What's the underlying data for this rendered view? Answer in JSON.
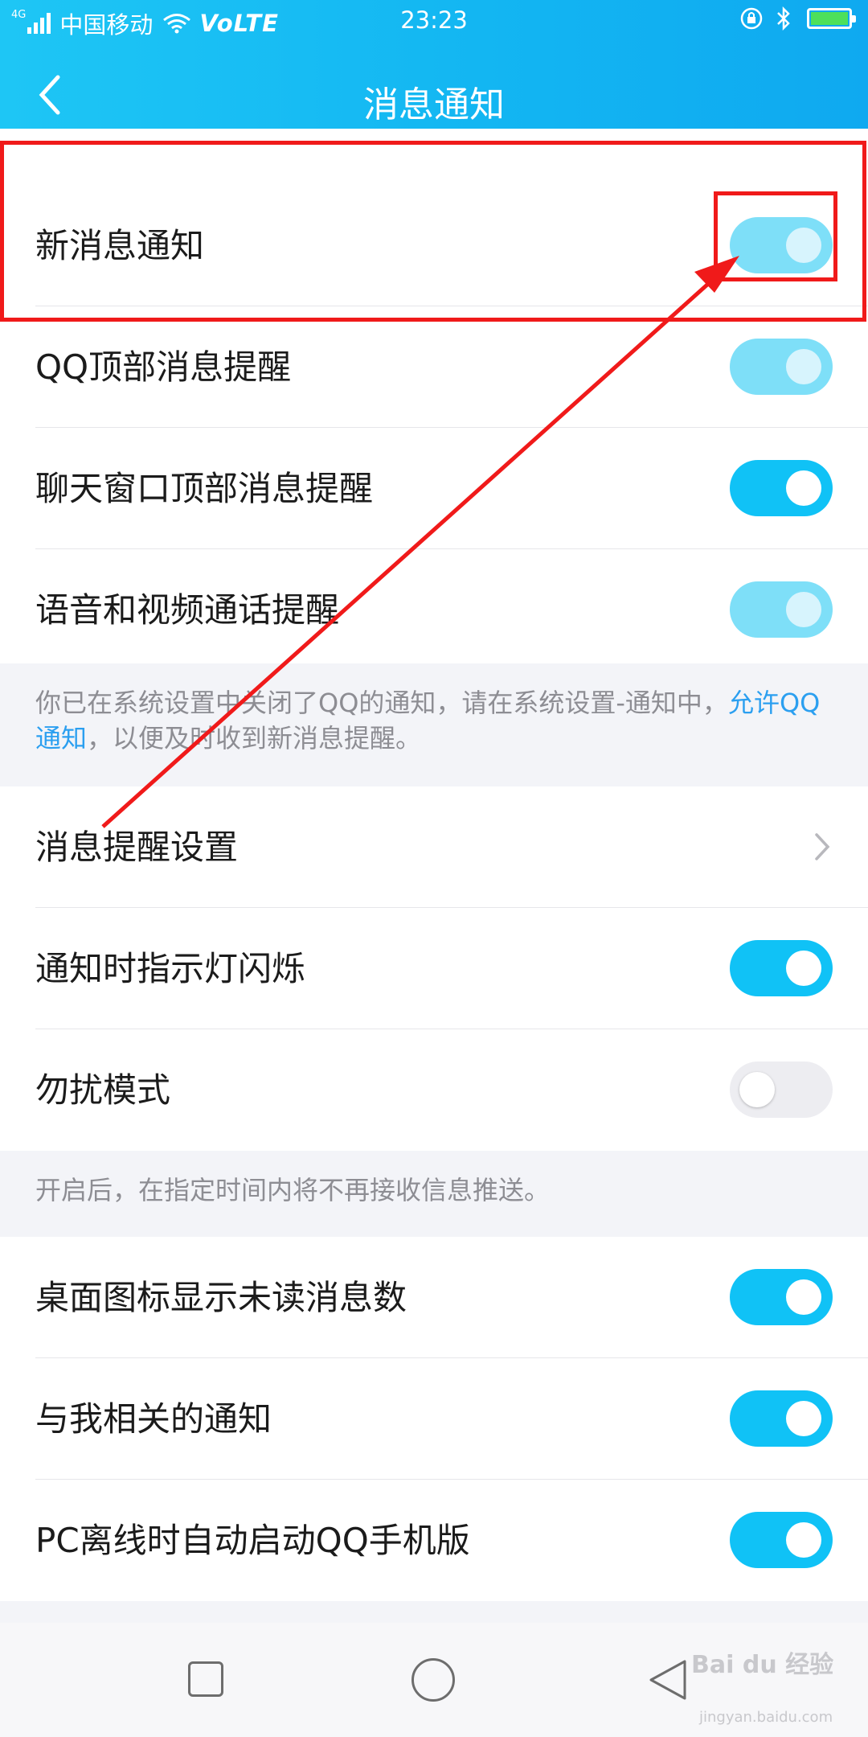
{
  "status_bar": {
    "network_small": "4G",
    "carrier": "中国移动",
    "volte": "VoLTE",
    "time": "23:23",
    "icons": [
      "signal-icon",
      "wifi-icon",
      "orientation-lock-icon",
      "bluetooth-icon",
      "battery-charging-icon"
    ]
  },
  "header": {
    "title": "消息通知",
    "back_icon": "back-chevron-icon"
  },
  "section1": {
    "items": [
      {
        "label": "新消息通知",
        "toggle": "on-disabled"
      },
      {
        "label": "QQ顶部消息提醒",
        "toggle": "on-disabled"
      },
      {
        "label": "聊天窗口顶部消息提醒",
        "toggle": "on"
      },
      {
        "label": "语音和视频通话提醒",
        "toggle": "on-disabled"
      }
    ]
  },
  "note1": {
    "text_before": "你已在系统设置中关闭了QQ的通知，请在系统设置-通知中，",
    "link": "允许QQ通知",
    "text_after": "，以便及时收到新消息提醒。"
  },
  "section2": {
    "items": [
      {
        "label": "消息提醒设置",
        "type": "chevron"
      },
      {
        "label": "通知时指示灯闪烁",
        "toggle": "on"
      },
      {
        "label": "勿扰模式",
        "toggle": "off"
      }
    ]
  },
  "note2": {
    "text": "开启后，在指定时间内将不再接收信息推送。"
  },
  "section3": {
    "items": [
      {
        "label": "桌面图标显示未读消息数",
        "toggle": "on"
      },
      {
        "label": "与我相关的通知",
        "toggle": "on"
      },
      {
        "label": "PC离线时自动启动QQ手机版",
        "toggle": "on"
      }
    ]
  },
  "navbar": {
    "icons": [
      "recent-apps-icon",
      "home-icon",
      "back-icon"
    ]
  },
  "watermark": {
    "text": "Bai du 经验",
    "sub": "jingyan.baidu.com"
  },
  "colors": {
    "header_start": "#1ec6f5",
    "header_end": "#0fa9f0",
    "toggle_on": "#10c2f6",
    "toggle_disabled": "#7edff8",
    "toggle_off": "#ededf1",
    "link": "#2b9ff0",
    "annotation": "#f01a1a"
  }
}
